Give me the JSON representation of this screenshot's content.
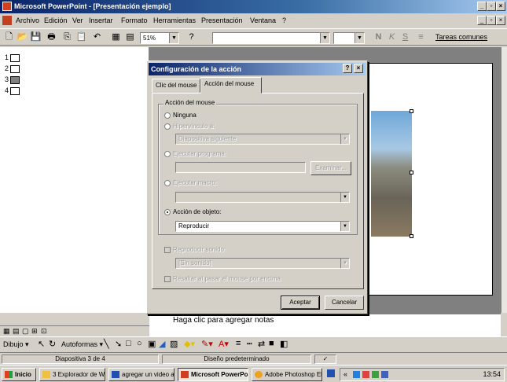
{
  "window": {
    "title": "Microsoft PowerPoint - [Presentación ejemplo]",
    "controls": [
      "_",
      "▫",
      "×"
    ]
  },
  "menu": [
    "Archivo",
    "Edición",
    "Ver",
    "Insertar",
    "Formato",
    "Herramientas",
    "Presentación",
    "Ventana",
    "?"
  ],
  "toolbar": {
    "zoom": "51%",
    "font_bold": "N",
    "font_italic": "K",
    "font_underline": "S",
    "tasks": "Tareas comunes"
  },
  "outline": {
    "slides": [
      "1",
      "2",
      "3",
      "4"
    ]
  },
  "dialog": {
    "title": "Configuración de la acción",
    "help_label": "?",
    "close_label": "×",
    "tabs": [
      "Clic del mouse",
      "Acción del mouse"
    ],
    "group_label": "Acción del mouse",
    "options": {
      "none": "Ninguna",
      "hyperlink": "Hipervínculo a:",
      "hyperlink_value": "Diapositiva siguiente",
      "run_program": "Ejecutar programa:",
      "browse": "Examinar...",
      "run_macro": "Ejecutar macro:",
      "object_action": "Acción de objeto:",
      "object_action_value": "Reproducir"
    },
    "play_sound": "Reproducir sonido:",
    "sound_value": "[Sin sonido]",
    "highlight": "Resaltar al pasar el mouse por encima",
    "ok": "Aceptar",
    "cancel": "Cancelar"
  },
  "notes": {
    "placeholder": "Haga clic para agregar notas"
  },
  "draw_toolbar": {
    "draw": "Dibujo",
    "autoshapes": "Autoformas"
  },
  "status": {
    "slide": "Diapositiva 3 de 4",
    "design": "Diseño predeterminado"
  },
  "taskbar": {
    "start": "Inicio",
    "items": [
      "3 Explorador de Wi...",
      "agregar un video a u...",
      "Microsoft PowerPo...",
      "Adobe Photoshop Ele..."
    ],
    "clock": "13:54"
  }
}
